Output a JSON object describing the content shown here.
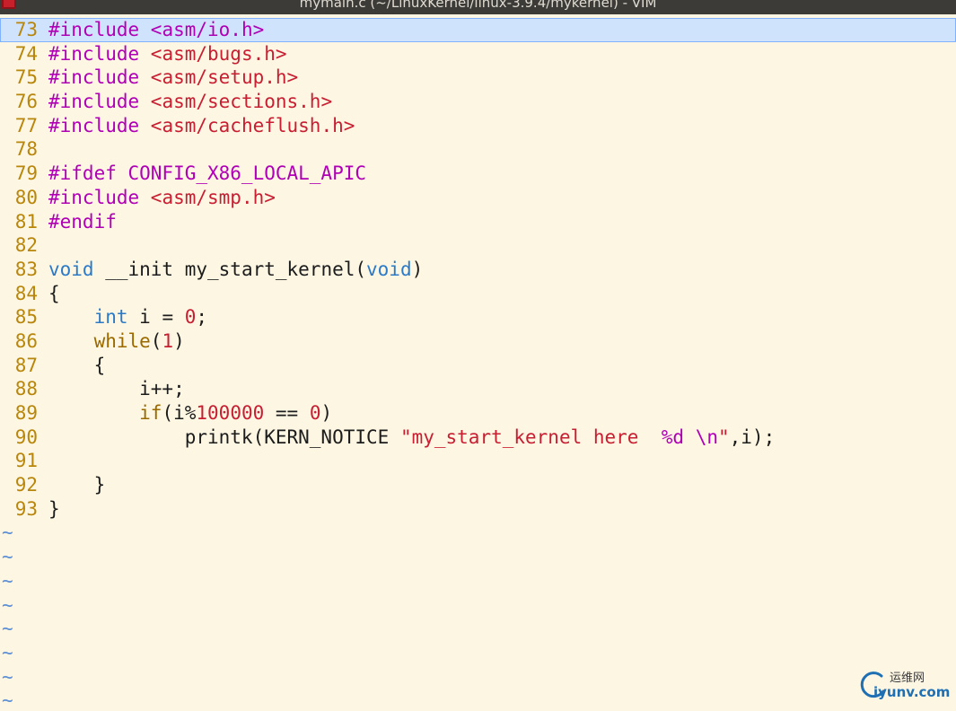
{
  "window": {
    "title": "mymain.c (~/LinuxKernel/linux-3.9.4/mykernel) - VIM"
  },
  "editor": {
    "lines": [
      {
        "num": "73",
        "tokens": [
          [
            "pp",
            "#include "
          ],
          [
            "str",
            "<asm/io.h>"
          ]
        ],
        "cursor": true
      },
      {
        "num": "74",
        "tokens": [
          [
            "pp",
            "#include "
          ],
          [
            "str",
            "<asm/bugs.h>"
          ]
        ]
      },
      {
        "num": "75",
        "tokens": [
          [
            "pp",
            "#include "
          ],
          [
            "str",
            "<asm/setup.h>"
          ]
        ]
      },
      {
        "num": "76",
        "tokens": [
          [
            "pp",
            "#include "
          ],
          [
            "str",
            "<asm/sections.h>"
          ]
        ]
      },
      {
        "num": "77",
        "tokens": [
          [
            "pp",
            "#include "
          ],
          [
            "str",
            "<asm/cacheflush.h>"
          ]
        ]
      },
      {
        "num": "78",
        "tokens": []
      },
      {
        "num": "79",
        "tokens": [
          [
            "pp",
            "#ifdef CONFIG_X86_LOCAL_APIC"
          ]
        ]
      },
      {
        "num": "80",
        "tokens": [
          [
            "pp",
            "#include "
          ],
          [
            "str",
            "<asm/smp.h>"
          ]
        ]
      },
      {
        "num": "81",
        "tokens": [
          [
            "pp",
            "#endif"
          ]
        ]
      },
      {
        "num": "82",
        "tokens": []
      },
      {
        "num": "83",
        "tokens": [
          [
            "type",
            "void"
          ],
          [
            "norm",
            " __init my_start_kernel("
          ],
          [
            "type",
            "void"
          ],
          [
            "norm",
            ")"
          ]
        ]
      },
      {
        "num": "84",
        "tokens": [
          [
            "norm",
            "{"
          ]
        ]
      },
      {
        "num": "85",
        "tokens": [
          [
            "norm",
            "    "
          ],
          [
            "type",
            "int"
          ],
          [
            "norm",
            " i = "
          ],
          [
            "num",
            "0"
          ],
          [
            "norm",
            ";"
          ]
        ]
      },
      {
        "num": "86",
        "tokens": [
          [
            "norm",
            "    "
          ],
          [
            "kw",
            "while"
          ],
          [
            "norm",
            "("
          ],
          [
            "num",
            "1"
          ],
          [
            "norm",
            ")"
          ]
        ]
      },
      {
        "num": "87",
        "tokens": [
          [
            "norm",
            "    {"
          ]
        ]
      },
      {
        "num": "88",
        "tokens": [
          [
            "norm",
            "        i++;"
          ]
        ]
      },
      {
        "num": "89",
        "tokens": [
          [
            "norm",
            "        "
          ],
          [
            "kw",
            "if"
          ],
          [
            "norm",
            "(i%"
          ],
          [
            "num",
            "100000"
          ],
          [
            "norm",
            " == "
          ],
          [
            "num",
            "0"
          ],
          [
            "norm",
            ")"
          ]
        ]
      },
      {
        "num": "90",
        "tokens": [
          [
            "norm",
            "            printk(KERN_NOTICE "
          ],
          [
            "str",
            "\"my_start_kernel here  "
          ],
          [
            "pp",
            "%d"
          ],
          [
            "norm",
            " "
          ],
          [
            "pp",
            "\\n"
          ],
          [
            "str",
            "\""
          ],
          [
            "norm",
            ",i);"
          ]
        ]
      },
      {
        "num": "91",
        "tokens": []
      },
      {
        "num": "92",
        "tokens": [
          [
            "norm",
            "    }"
          ]
        ]
      },
      {
        "num": "93",
        "tokens": [
          [
            "norm",
            "}"
          ]
        ]
      }
    ],
    "tilde_rows": [
      "~",
      "~",
      "~",
      "~",
      "~",
      "~",
      "~",
      "~"
    ]
  },
  "watermark": {
    "top_text": "运维网",
    "bottom_text": "iyunv.com"
  },
  "colors": {
    "background": "#fdf6e3",
    "cursorline": "#cfe3fd",
    "line_number": "#b8860b",
    "preprocessor": "#b000b5",
    "string": "#c81e32",
    "type": "#2b7ac8",
    "keyword": "#9a6a00",
    "tilde": "#5c8ed6"
  }
}
